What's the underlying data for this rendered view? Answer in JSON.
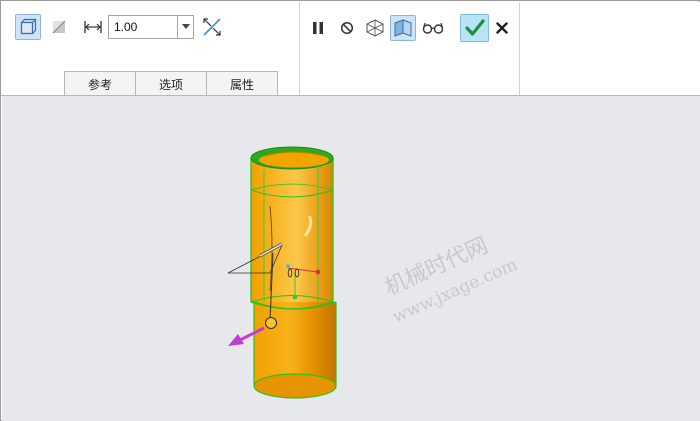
{
  "toolbar": {
    "thickness_value": "1.00",
    "icons": [
      "solid-icon",
      "surface-icon",
      "dimension-icon",
      "flip-direction-icon",
      "pause-icon",
      "no-preview-icon",
      "mesh-preview-icon",
      "verify-preview-icon",
      "glasses-icon",
      "ok-check-icon",
      "cancel-x-icon"
    ]
  },
  "tabs": [
    {
      "label": "参考"
    },
    {
      "label": "选项"
    },
    {
      "label": "属性"
    }
  ],
  "watermark": {
    "line1": "机械时代网",
    "line2": "www.jxage.com"
  },
  "colors": {
    "ribbon_bg": "#ffffff",
    "viewport_bg": "#e7e8ec",
    "model_orange": "#f5a000",
    "edge_green": "#2fbf1f",
    "accept_bg": "#b9e3f7",
    "direction_arrow": "#c23bd6"
  }
}
